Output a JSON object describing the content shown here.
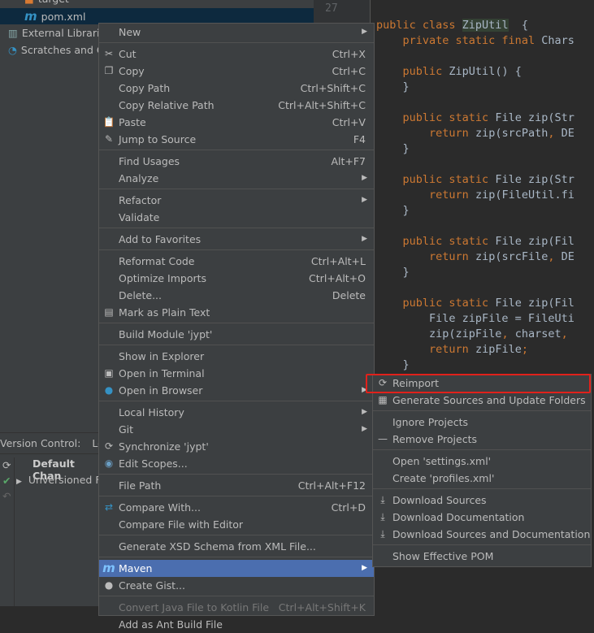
{
  "project_tree": [
    {
      "label": "target",
      "icon": "folder-icon",
      "indent": 30
    },
    {
      "label": "pom.xml",
      "icon": "maven-icon",
      "indent": 30,
      "selected": true
    },
    {
      "label": "External Libraries",
      "icon": "libraries-icon",
      "indent": 10
    },
    {
      "label": "Scratches and C",
      "icon": "scratches-icon",
      "indent": 10
    }
  ],
  "gutter": {
    "line_number": "27"
  },
  "code": [
    {
      "y": 0,
      "t": [
        [
          "kw",
          "public class "
        ],
        [
          "cls",
          "ZipUtil"
        ],
        [
          "",
          "  {"
        ]
      ]
    },
    {
      "y": 1,
      "t": [
        [
          "",
          "    "
        ],
        [
          "kw",
          "private static final "
        ],
        [
          "",
          "Chars"
        ]
      ]
    },
    {
      "y": 3,
      "t": [
        [
          "",
          "    "
        ],
        [
          "kw",
          "public "
        ],
        [
          "",
          "ZipUtil() {"
        ]
      ]
    },
    {
      "y": 4,
      "t": [
        [
          "",
          "    }"
        ]
      ]
    },
    {
      "y": 6,
      "t": [
        [
          "",
          "    "
        ],
        [
          "kw",
          "public static "
        ],
        [
          "",
          "File zip(Str"
        ]
      ]
    },
    {
      "y": 7,
      "t": [
        [
          "",
          "        "
        ],
        [
          "kw",
          "return "
        ],
        [
          "",
          "zip(srcPath"
        ],
        [
          "kw",
          ", "
        ],
        [
          "",
          "DE"
        ]
      ]
    },
    {
      "y": 8,
      "t": [
        [
          "",
          "    }"
        ]
      ]
    },
    {
      "y": 10,
      "t": [
        [
          "",
          "    "
        ],
        [
          "kw",
          "public static "
        ],
        [
          "",
          "File zip(Str"
        ]
      ]
    },
    {
      "y": 11,
      "t": [
        [
          "",
          "        "
        ],
        [
          "kw",
          "return "
        ],
        [
          "",
          "zip(FileUtil.fi"
        ]
      ]
    },
    {
      "y": 12,
      "t": [
        [
          "",
          "    }"
        ]
      ]
    },
    {
      "y": 14,
      "t": [
        [
          "",
          "    "
        ],
        [
          "kw",
          "public static "
        ],
        [
          "",
          "File zip(Fil"
        ]
      ]
    },
    {
      "y": 15,
      "t": [
        [
          "",
          "        "
        ],
        [
          "kw",
          "return "
        ],
        [
          "",
          "zip(srcFile"
        ],
        [
          "kw",
          ", "
        ],
        [
          "",
          "DE"
        ]
      ]
    },
    {
      "y": 16,
      "t": [
        [
          "",
          "    }"
        ]
      ]
    },
    {
      "y": 18,
      "t": [
        [
          "",
          "    "
        ],
        [
          "kw",
          "public static "
        ],
        [
          "",
          "File zip(Fil"
        ]
      ]
    },
    {
      "y": 19,
      "t": [
        [
          "",
          "        File zipFile = FileUti"
        ]
      ]
    },
    {
      "y": 20,
      "t": [
        [
          "",
          "        zip(zipFile"
        ],
        [
          "kw",
          ", "
        ],
        [
          "",
          "charset"
        ],
        [
          "kw",
          ","
        ]
      ]
    },
    {
      "y": 21,
      "t": [
        [
          "",
          "        "
        ],
        [
          "kw",
          "return "
        ],
        [
          "",
          "zipFile"
        ],
        [
          "kw",
          ";"
        ]
      ]
    },
    {
      "y": 22,
      "t": [
        [
          "",
          "    }"
        ]
      ]
    }
  ],
  "version_control": {
    "label": "Version Control:",
    "tab": "Lo",
    "default_changelist": "Default Chan",
    "unversioned": "Unversioned F"
  },
  "context_menu": [
    [
      {
        "label": "New",
        "submenu": true
      }
    ],
    [
      {
        "label": "Cut",
        "shortcut": "Ctrl+X",
        "icon": "cut-icon"
      },
      {
        "label": "Copy",
        "shortcut": "Ctrl+C",
        "icon": "copy-icon"
      },
      {
        "label": "Copy Path",
        "shortcut": "Ctrl+Shift+C"
      },
      {
        "label": "Copy Relative Path",
        "shortcut": "Ctrl+Alt+Shift+C"
      },
      {
        "label": "Paste",
        "shortcut": "Ctrl+V",
        "icon": "paste-icon"
      },
      {
        "label": "Jump to Source",
        "shortcut": "F4",
        "icon": "edit-icon"
      }
    ],
    [
      {
        "label": "Find Usages",
        "shortcut": "Alt+F7"
      },
      {
        "label": "Analyze",
        "submenu": true
      }
    ],
    [
      {
        "label": "Refactor",
        "submenu": true
      },
      {
        "label": "Validate"
      }
    ],
    [
      {
        "label": "Add to Favorites",
        "submenu": true
      }
    ],
    [
      {
        "label": "Reformat Code",
        "shortcut": "Ctrl+Alt+L"
      },
      {
        "label": "Optimize Imports",
        "shortcut": "Ctrl+Alt+O"
      },
      {
        "label": "Delete...",
        "shortcut": "Delete"
      },
      {
        "label": "Mark as Plain Text",
        "icon": "plain-text-icon"
      }
    ],
    [
      {
        "label": "Build Module 'jypt'"
      }
    ],
    [
      {
        "label": "Show in Explorer"
      },
      {
        "label": "Open in Terminal",
        "icon": "terminal-icon"
      },
      {
        "label": "Open in Browser",
        "icon": "globe-icon",
        "submenu": true
      }
    ],
    [
      {
        "label": "Local History",
        "submenu": true
      },
      {
        "label": "Git",
        "submenu": true
      },
      {
        "label": "Synchronize 'jypt'",
        "icon": "sync-icon"
      },
      {
        "label": "Edit Scopes...",
        "icon": "scope-icon"
      }
    ],
    [
      {
        "label": "File Path",
        "shortcut": "Ctrl+Alt+F12"
      }
    ],
    [
      {
        "label": "Compare With...",
        "shortcut": "Ctrl+D",
        "icon": "compare-icon"
      },
      {
        "label": "Compare File with Editor"
      }
    ],
    [
      {
        "label": "Generate XSD Schema from XML File..."
      }
    ],
    [
      {
        "label": "Maven",
        "icon": "maven-icon",
        "submenu": true,
        "highlighted": true
      },
      {
        "label": "Create Gist...",
        "icon": "github-icon"
      }
    ],
    [
      {
        "label": "Convert Java File to Kotlin File",
        "shortcut": "Ctrl+Alt+Shift+K",
        "disabled": true
      },
      {
        "label": "Add as Ant Build File"
      }
    ]
  ],
  "maven_submenu": [
    [
      {
        "label": "Reimport",
        "icon": "reimport-icon",
        "annotated": true
      },
      {
        "label": "Generate Sources and Update Folders",
        "icon": "generate-sources-icon"
      }
    ],
    [
      {
        "label": "Ignore Projects"
      },
      {
        "label": "Remove Projects",
        "icon": "minus-icon"
      }
    ],
    [
      {
        "label": "Open 'settings.xml'"
      },
      {
        "label": "Create 'profiles.xml'"
      }
    ],
    [
      {
        "label": "Download Sources",
        "icon": "download-icon"
      },
      {
        "label": "Download Documentation",
        "icon": "download-icon"
      },
      {
        "label": "Download Sources and Documentation",
        "icon": "download-icon"
      }
    ],
    [
      {
        "label": "Show Effective POM"
      }
    ]
  ],
  "colors": {
    "highlight": "#4b6eaf",
    "annotation": "#e0211b",
    "keyword": "#cc7832",
    "selection": "#0d293e"
  }
}
